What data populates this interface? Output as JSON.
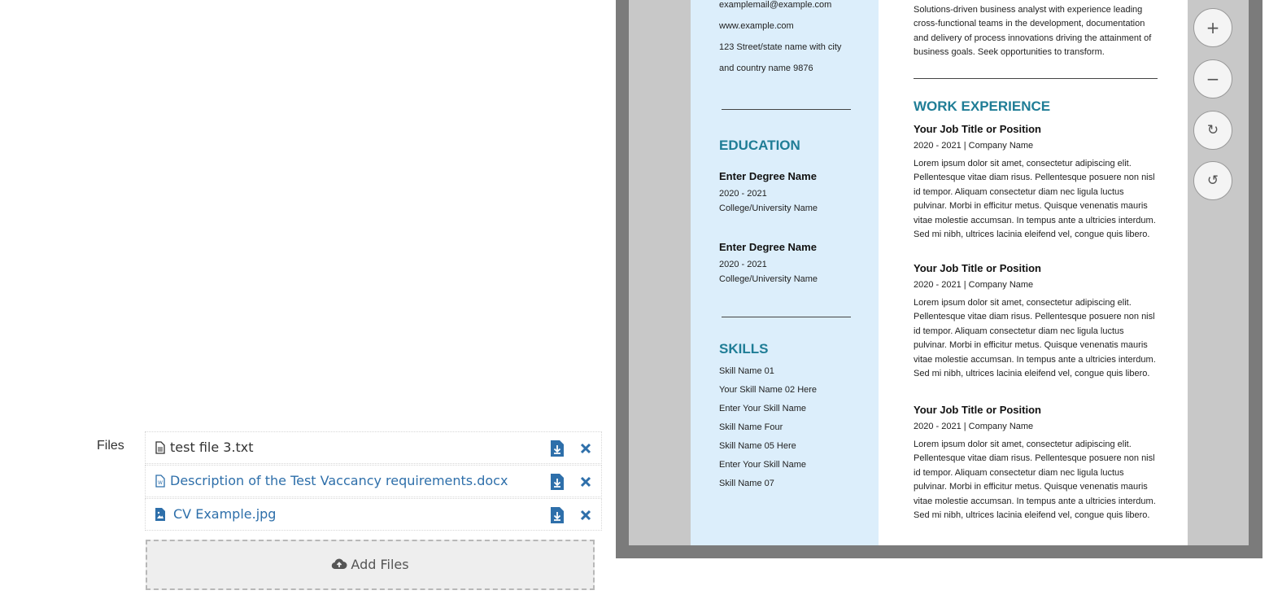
{
  "files_section": {
    "label": "Files",
    "items": [
      {
        "name": "test file 3.txt",
        "icon": "text-file-icon"
      },
      {
        "name": "Description of the Test Vaccancy requirements.docx",
        "icon": "word-file-icon"
      },
      {
        "name": "CV Example.jpg",
        "icon": "image-file-icon"
      }
    ],
    "add_label": "Add Files"
  },
  "colors": {
    "link": "#2e6faa",
    "heading": "#1f7d96",
    "sidebar": "#dceefb"
  },
  "viewer": {
    "controls": [
      "+",
      "−",
      "↻",
      "↺"
    ],
    "resume": {
      "contact": [
        "examplemail@example.com",
        "www.example.com",
        "123 Street/state name with city",
        "and country name 9876"
      ],
      "summary_lines": [
        "Solutions-driven business analyst with experience leading",
        "cross-functional teams in the development, documentation",
        "and delivery of process innovations driving the attainment of",
        "business goals. Seek opportunities to transform."
      ],
      "education": {
        "heading": "EDUCATION",
        "entries": [
          {
            "degree": "Enter  Degree Name",
            "years": "2020 - 2021",
            "school": "College/University Name"
          },
          {
            "degree": "Enter  Degree Name",
            "years": "2020 - 2021",
            "school": "College/University Name"
          }
        ]
      },
      "skills": {
        "heading": "SKILLS",
        "items": [
          "Skill Name 01",
          "Your Skill Name 02 Here",
          "Enter Your Skill Name",
          "Skill Name Four",
          "Skill Name 05 Here",
          "Enter Your Skill Name",
          "Skill Name 07"
        ]
      },
      "experience": {
        "heading": "WORK EXPERIENCE",
        "jobs": [
          {
            "title": "Your Job Title or Position",
            "meta": "2020 - 2021 | Company Name"
          },
          {
            "title": "Your Job Title or Position",
            "meta": "2020 - 2021 | Company Name"
          },
          {
            "title": "Your Job Title or Position",
            "meta": "2020 - 2021 | Company Name"
          }
        ],
        "body_lines": [
          "Lorem ipsum dolor sit amet, consectetur adipiscing elit.",
          "Pellentesque vitae diam risus. Pellentesque posuere non nisl",
          "id tempor. Aliquam consectetur diam nec ligula luctus",
          "pulvinar. Morbi in efficitur metus. Quisque venenatis mauris",
          "vitae molestie accumsan. In tempus ante a ultricies interdum.",
          "Sed mi nibh, ultrices lacinia eleifend vel, congue quis libero."
        ]
      }
    }
  }
}
